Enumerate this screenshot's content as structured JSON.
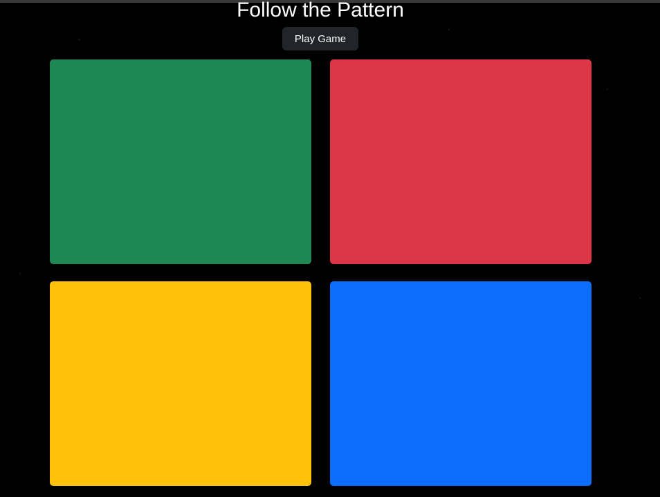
{
  "header": {
    "title": "Follow the Pattern",
    "play_button_label": "Play Game"
  },
  "colors": {
    "background": "#000000",
    "button_background": "#212529",
    "text": "#ffffff"
  },
  "pads": [
    {
      "name": "green",
      "color": "#1e8754"
    },
    {
      "name": "red",
      "color": "#dc3545"
    },
    {
      "name": "yellow",
      "color": "#ffc10a"
    },
    {
      "name": "blue",
      "color": "#0d6efd"
    }
  ]
}
